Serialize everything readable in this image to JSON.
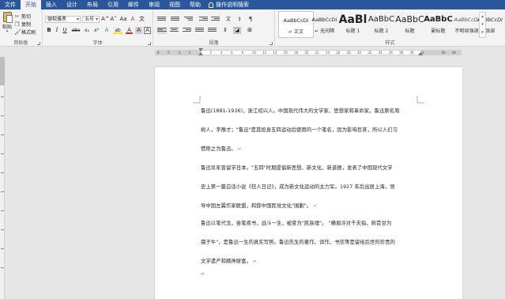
{
  "tabs": [
    {
      "label": "文件",
      "active": false
    },
    {
      "label": "开始",
      "active": true
    },
    {
      "label": "插入",
      "active": false
    },
    {
      "label": "设计",
      "active": false
    },
    {
      "label": "布局",
      "active": false
    },
    {
      "label": "引用",
      "active": false
    },
    {
      "label": "邮件",
      "active": false
    },
    {
      "label": "审阅",
      "active": false
    },
    {
      "label": "视图",
      "active": false
    },
    {
      "label": "帮助",
      "active": false
    }
  ],
  "tell_me": "操作说明搜索",
  "clipboard": {
    "paste": "粘贴",
    "cut": "剪切",
    "copy": "复制",
    "format_painter": "格式刷",
    "group_label": "剪贴板"
  },
  "font": {
    "name": "微软雅黑",
    "size": "五号",
    "group_label": "字体",
    "bold": "B",
    "italic": "I",
    "underline": "U",
    "strike": "abc",
    "sub": "x₂",
    "sup": "x²",
    "grow": "A^",
    "shrink": "A˅",
    "case": "Aa",
    "clear": "A",
    "wen": "文",
    "text_effects": "A",
    "highlight": "ab",
    "font_color": "A",
    "char_shade": "A",
    "phonetic": "A"
  },
  "paragraph": {
    "group_label": "段落"
  },
  "styles": {
    "group_label": "样式",
    "items": [
      {
        "sample": "AaBbCcDi",
        "name": "↵ 正文",
        "selected": true
      },
      {
        "sample": "AaBbCcDi",
        "name": "↵ 无间隔",
        "selected": false
      },
      {
        "sample": "AaBl",
        "name": "标题 1",
        "selected": false
      },
      {
        "sample": "AaBbC",
        "name": "标题 2",
        "selected": false
      },
      {
        "sample": "AaBbC",
        "name": "标题",
        "selected": false
      },
      {
        "sample": "AaBbC",
        "name": "副标题",
        "selected": false
      },
      {
        "sample": "AaBbCcDi",
        "name": "不明显强调",
        "selected": false
      },
      {
        "sample": "AaBbCcDi",
        "name": "强调",
        "selected": false
      }
    ]
  },
  "ruler": {
    "ticks": [
      "8",
      "6",
      "4",
      "2",
      "",
      "2",
      "4",
      "6",
      "8",
      "10",
      "12",
      "14",
      "16",
      "18",
      "20",
      "22",
      "24",
      "26",
      "28",
      "30",
      "32",
      "34",
      "36",
      "38",
      "40",
      "42",
      "",
      "46",
      "48"
    ]
  },
  "document": {
    "paragraphs": [
      {
        "lines": [
          "鲁迅(1881-1936)，浙江绍兴人。中国现代伟大的文学家、思想家和革命家。鲁迅原名周",
          "树人，字豫才；\"鲁迅\"是其投身五四运动后使用的一个笔名，因为影响巨甚，所以人们习",
          "惯称之为鲁迅。"
        ]
      },
      {
        "lines": [
          "鲁迅早年曾留学日本。\"五四\"时期提倡新思想、新文化、新道德，发表了中国现代文学",
          "史上第一篇白话小说《狂人日记》，成为新文化运动的主力军。1927 年后出居上海，领",
          "导中国左翼作家联盟，和辞中国民党文化\"围剿\"。"
        ]
      },
      {
        "lines": [
          "鲁迅以笔代戈，奋笔疾书，战斗一生，被誉为\"民族魂\"。  \"横眉冷对千夫指，俯首甘为",
          "孺子牛\"，是鲁迅一生的真实写照。鲁迅先生的著作、译作、书信等是留给后世的珍贵的",
          "文学遗产和精神财富。"
        ]
      }
    ],
    "paragraph_mark": "↵",
    "end_mark": "↵"
  },
  "colors": {
    "tab_bar": "#2b579a",
    "ribbon": "#f3f3f3",
    "workspace": "#e6e6e6",
    "font_color_red": "#e8291e",
    "highlight_yellow": "#ffe600"
  }
}
